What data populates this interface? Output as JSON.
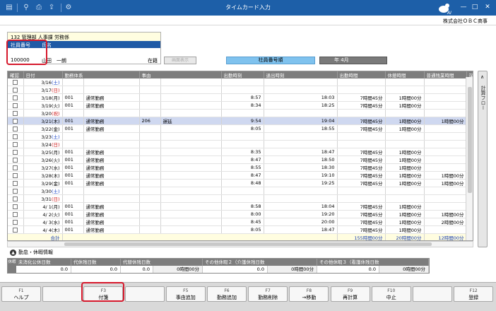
{
  "titlebar": {
    "title": "タイムカード入力"
  },
  "company": "株式会社ＯＢＣ商事",
  "employee": {
    "department": "132 管理部 人事課 労務係",
    "id_header": "社員番号",
    "name_header": "氏名",
    "id": "100000",
    "name": "山田　一朗",
    "status": "在籍"
  },
  "controls": {
    "display_button": "画面表示",
    "sort_label": "社員番号順",
    "month": "年 4月"
  },
  "grid": {
    "headers": [
      "確認",
      "日付",
      "勤務体系",
      "",
      "事由",
      "",
      "出勤時刻",
      "退出時刻",
      "出勤時間",
      "休憩時間",
      "普通残業時間",
      "深夜"
    ],
    "rows": [
      {
        "date": "3/16",
        "dow": "(土)",
        "day_type": "sat",
        "code": "",
        "kind": "",
        "rcode": "",
        "reason": "",
        "in": "",
        "out": "",
        "work": "",
        "rest": "",
        "ot": ""
      },
      {
        "date": "3/17",
        "dow": "(日)",
        "day_type": "sun",
        "code": "",
        "kind": "",
        "rcode": "",
        "reason": "",
        "in": "",
        "out": "",
        "work": "",
        "rest": "",
        "ot": ""
      },
      {
        "date": "3/18",
        "dow": "(月)",
        "day_type": "",
        "code": "001",
        "kind": "通常勤務",
        "rcode": "",
        "reason": "",
        "in": "8:57",
        "out": "18:03",
        "work": "7時間45分",
        "rest": "1時間00分",
        "ot": ""
      },
      {
        "date": "3/19",
        "dow": "(火)",
        "day_type": "",
        "code": "001",
        "kind": "通常勤務",
        "rcode": "",
        "reason": "",
        "in": "8:34",
        "out": "18:25",
        "work": "7時間45分",
        "rest": "1時間00分",
        "ot": ""
      },
      {
        "date": "3/20",
        "dow": "(祝)",
        "day_type": "sun",
        "code": "",
        "kind": "",
        "rcode": "",
        "reason": "",
        "in": "",
        "out": "",
        "work": "",
        "rest": "",
        "ot": ""
      },
      {
        "date": "3/21",
        "dow": "(木)",
        "day_type": "",
        "code": "001",
        "kind": "通常勤務",
        "rcode": "206",
        "reason": "遅延",
        "in": "9:54",
        "out": "19:04",
        "work": "7時間45分",
        "rest": "1時間00分",
        "ot": "1時間00分",
        "selected": true
      },
      {
        "date": "3/22",
        "dow": "(金)",
        "day_type": "",
        "code": "001",
        "kind": "通常勤務",
        "rcode": "",
        "reason": "",
        "in": "8:05",
        "out": "18:55",
        "work": "7時間45分",
        "rest": "1時間00分",
        "ot": ""
      },
      {
        "date": "3/23",
        "dow": "(土)",
        "day_type": "sat",
        "code": "",
        "kind": "",
        "rcode": "",
        "reason": "",
        "in": "",
        "out": "",
        "work": "",
        "rest": "",
        "ot": ""
      },
      {
        "date": "3/24",
        "dow": "(日)",
        "day_type": "sun",
        "code": "",
        "kind": "",
        "rcode": "",
        "reason": "",
        "in": "",
        "out": "",
        "work": "",
        "rest": "",
        "ot": ""
      },
      {
        "date": "3/25",
        "dow": "(月)",
        "day_type": "",
        "code": "001",
        "kind": "通常勤務",
        "rcode": "",
        "reason": "",
        "in": "8:35",
        "out": "18:47",
        "work": "7時間45分",
        "rest": "1時間00分",
        "ot": ""
      },
      {
        "date": "3/26",
        "dow": "(火)",
        "day_type": "",
        "code": "001",
        "kind": "通常勤務",
        "rcode": "",
        "reason": "",
        "in": "8:47",
        "out": "18:50",
        "work": "7時間45分",
        "rest": "1時間00分",
        "ot": ""
      },
      {
        "date": "3/27",
        "dow": "(水)",
        "day_type": "",
        "code": "001",
        "kind": "通常勤務",
        "rcode": "",
        "reason": "",
        "in": "8:55",
        "out": "18:30",
        "work": "7時間45分",
        "rest": "1時間00分",
        "ot": ""
      },
      {
        "date": "3/28",
        "dow": "(木)",
        "day_type": "",
        "code": "001",
        "kind": "通常勤務",
        "rcode": "",
        "reason": "",
        "in": "8:47",
        "out": "19:10",
        "work": "7時間45分",
        "rest": "1時間00分",
        "ot": "1時間00分"
      },
      {
        "date": "3/29",
        "dow": "(金)",
        "day_type": "",
        "code": "001",
        "kind": "通常勤務",
        "rcode": "",
        "reason": "",
        "in": "8:48",
        "out": "19:25",
        "work": "7時間45分",
        "rest": "1時間00分",
        "ot": "1時間00分"
      },
      {
        "date": "3/30",
        "dow": "(土)",
        "day_type": "sat",
        "code": "",
        "kind": "",
        "rcode": "",
        "reason": "",
        "in": "",
        "out": "",
        "work": "",
        "rest": "",
        "ot": ""
      },
      {
        "date": "3/31",
        "dow": "(日)",
        "day_type": "sun",
        "code": "",
        "kind": "",
        "rcode": "",
        "reason": "",
        "in": "",
        "out": "",
        "work": "",
        "rest": "",
        "ot": ""
      },
      {
        "date": "4/ 1",
        "dow": "(月)",
        "day_type": "",
        "code": "001",
        "kind": "通常勤務",
        "rcode": "",
        "reason": "",
        "in": "8:58",
        "out": "18:04",
        "work": "7時間45分",
        "rest": "1時間00分",
        "ot": ""
      },
      {
        "date": "4/ 2",
        "dow": "(火)",
        "day_type": "",
        "code": "001",
        "kind": "通常勤務",
        "rcode": "",
        "reason": "",
        "in": "8:00",
        "out": "19:20",
        "work": "7時間45分",
        "rest": "1時間00分",
        "ot": "1時間00分"
      },
      {
        "date": "4/ 3",
        "dow": "(水)",
        "day_type": "",
        "code": "001",
        "kind": "通常勤務",
        "rcode": "",
        "reason": "",
        "in": "8:45",
        "out": "20:00",
        "work": "7時間45分",
        "rest": "1時間00分",
        "ot": "2時間00分"
      },
      {
        "date": "4/ 4",
        "dow": "(木)",
        "day_type": "",
        "code": "001",
        "kind": "通常勤務",
        "rcode": "",
        "reason": "",
        "in": "8:05",
        "out": "18:47",
        "work": "7時間45分",
        "rest": "1時間00分",
        "ot": ""
      }
    ],
    "total": {
      "label": "合計",
      "work": "155時間00分",
      "rest": "20時間00分",
      "ot": "12時間00分"
    }
  },
  "side_tab": "計算フロー",
  "leave": {
    "title": "勤怠・休暇情報",
    "side_label": "休暇",
    "headers": [
      "未消化公休日数",
      "代休残日数",
      "代替休残日数",
      "その他休暇２（介護休残日数",
      "その他休暇３（看護休残日数"
    ],
    "values": [
      "0.0",
      "0.0",
      "0.0",
      "0時間00分",
      "0.0",
      "0時間00分",
      "0.0",
      "0時間00分"
    ]
  },
  "fkeys": [
    {
      "key": "F1",
      "label": "ヘルプ"
    },
    {
      "key": "",
      "label": ""
    },
    {
      "key": "F3",
      "label": "付箋"
    },
    {
      "key": "",
      "label": ""
    },
    {
      "key": "F5",
      "label": "事由追加"
    },
    {
      "key": "F6",
      "label": "勤務追加"
    },
    {
      "key": "F7",
      "label": "勤務削除"
    },
    {
      "key": "F8",
      "label": "→移動"
    },
    {
      "key": "F9",
      "label": "再計算"
    },
    {
      "key": "F10",
      "label": "中止"
    },
    {
      "key": "",
      "label": ""
    },
    {
      "key": "F12",
      "label": "登録"
    }
  ]
}
